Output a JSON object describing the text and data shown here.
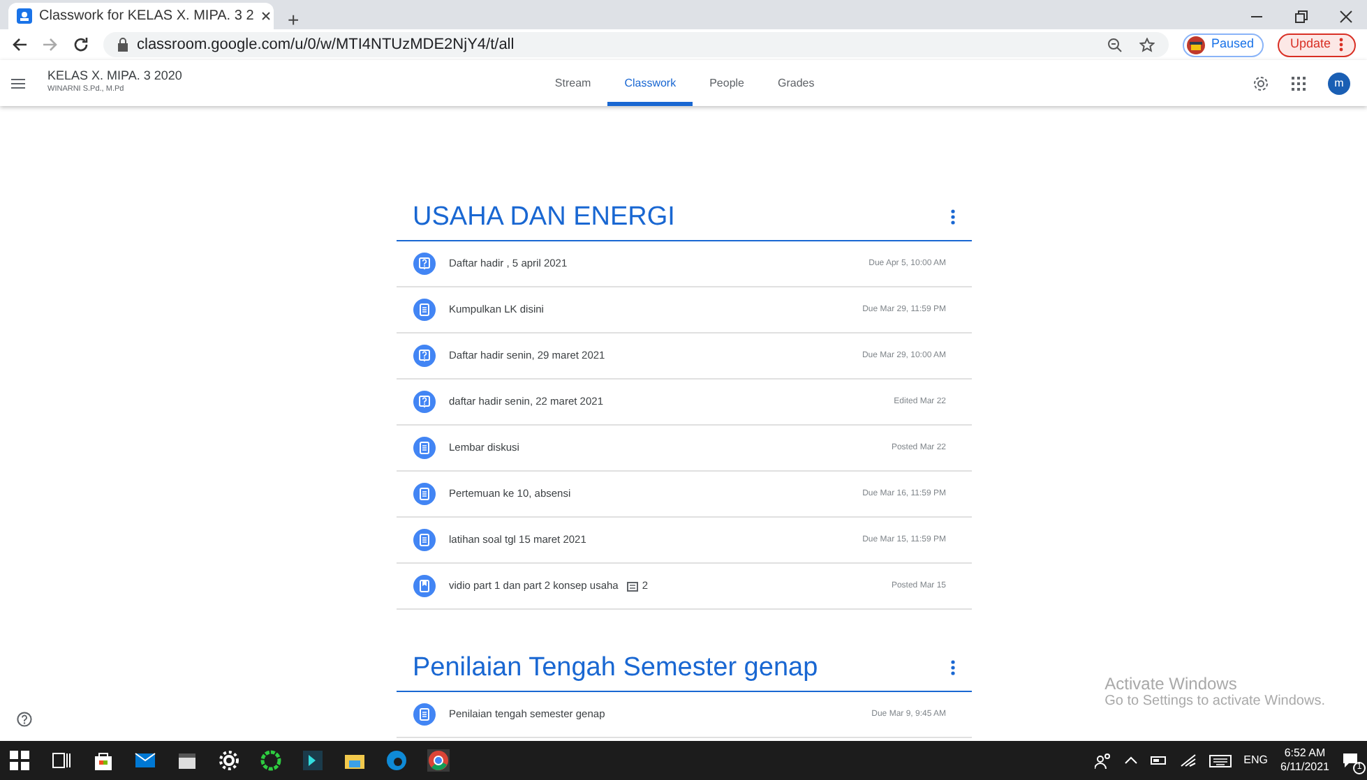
{
  "browser": {
    "tab_title": "Classwork for KELAS X. MIPA. 3 2",
    "new_tab": "+",
    "url": "classroom.google.com/u/0/w/MTI4NTUzMDE2NjY4/t/all",
    "profile": "Paused",
    "update": "Update"
  },
  "app_header": {
    "class_name": "KELAS X. MIPA. 3 2020",
    "teacher": "WINARNI S.Pd., M.Pd",
    "avatar": "m",
    "tabs": [
      {
        "label": "Stream",
        "selected": false
      },
      {
        "label": "Classwork",
        "selected": true
      },
      {
        "label": "People",
        "selected": false
      },
      {
        "label": "Grades",
        "selected": false
      }
    ]
  },
  "topics": [
    {
      "title": "USAHA DAN ENERGI",
      "items": [
        {
          "kind": "question",
          "title": "Daftar hadir , 5 april 2021",
          "meta": "Due Apr 5, 10:00 AM"
        },
        {
          "kind": "assignment",
          "title": "Kumpulkan LK disini",
          "meta": "Due Mar 29, 11:59 PM"
        },
        {
          "kind": "question",
          "title": "Daftar hadir senin, 29 maret 2021",
          "meta": "Due Mar 29, 10:00 AM"
        },
        {
          "kind": "question",
          "title": "daftar hadir senin, 22 maret 2021",
          "meta": "Edited Mar 22"
        },
        {
          "kind": "assignment",
          "title": "Lembar diskusi",
          "meta": "Posted Mar 22"
        },
        {
          "kind": "assignment",
          "title": "Pertemuan ke 10, absensi",
          "meta": "Due Mar 16, 11:59 PM"
        },
        {
          "kind": "assignment",
          "title": "latihan soal tgl 15 maret 2021",
          "meta": "Due Mar 15, 11:59 PM"
        },
        {
          "kind": "material",
          "title": "vidio part 1 dan part 2 konsep usaha",
          "comments": "2",
          "meta": "Posted Mar 15"
        }
      ]
    },
    {
      "title": "Penilaian Tengah Semester genap",
      "items": [
        {
          "kind": "assignment",
          "title": "Penilaian tengah semester genap",
          "meta": "Due Mar 9, 9:45 AM"
        }
      ]
    }
  ],
  "activation_notice": {
    "title": "Activate Windows",
    "text": "Go to Settings to activate Windows."
  },
  "taskbar": {
    "language": "ENG",
    "time": "6:52 AM",
    "date": "6/11/2021",
    "notifications": "1"
  }
}
